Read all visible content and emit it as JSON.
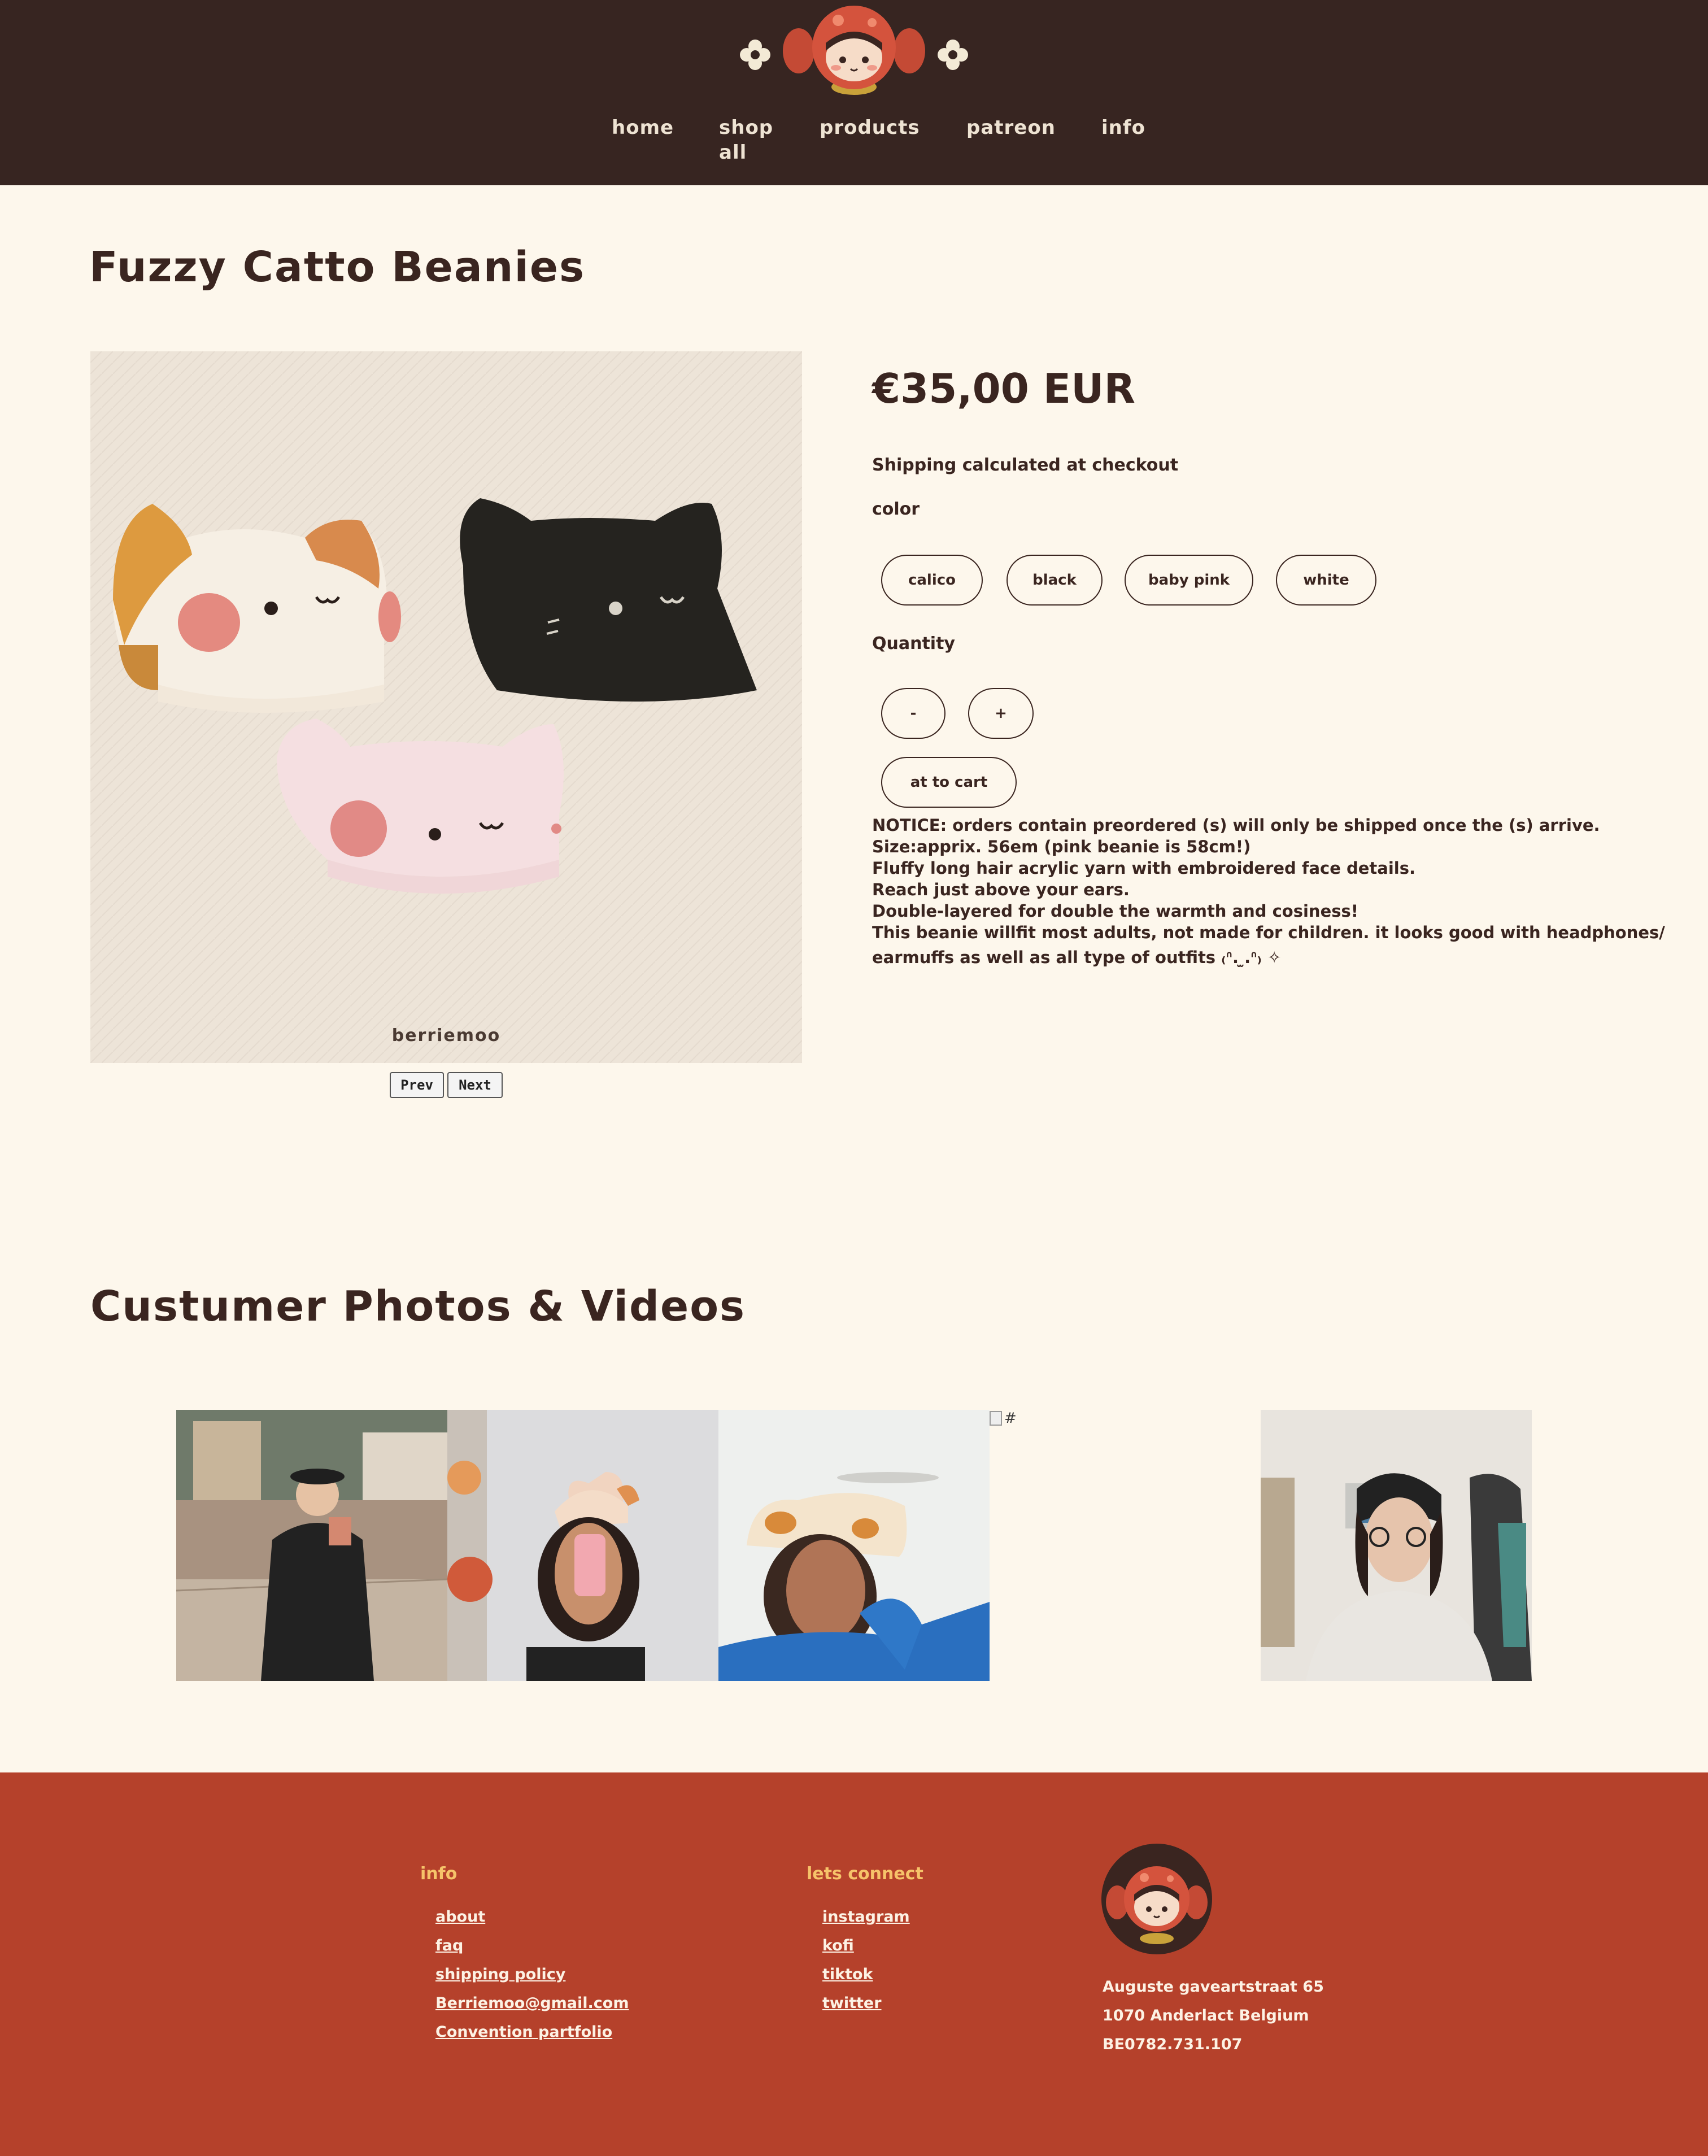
{
  "nav": {
    "items": [
      {
        "label": "home"
      },
      {
        "label": "shop\nall"
      },
      {
        "label": "products"
      },
      {
        "label": "patreon"
      },
      {
        "label": "info"
      }
    ]
  },
  "product": {
    "title": "Fuzzy Catto Beanies",
    "image_caption": "berriemoo",
    "prev_label": "Prev",
    "next_label": "Next",
    "price": "€35,00 EUR",
    "shipping_note": "Shipping calculated at checkout",
    "color_label": "color",
    "colors": [
      "calico",
      "black",
      "baby pink",
      "white"
    ],
    "quantity_label": "Quantity",
    "minus_label": "-",
    "plus_label": "+",
    "add_to_cart_label": "at to cart",
    "description": [
      "NOTICE: orders contain preordered (s) will only be shipped once the (s) arrive.",
      "Size:apprix. 56em (pink beanie is 58cm!)",
      "Fluffy long hair acrylic yarn with embroidered face details.",
      "Reach just above your ears.",
      "Double-layered for double the warmth and cosiness!",
      "This beanie willfit most adults, not made for children. it looks good with headphones/",
      "earmuffs as well as all type of outfits ₍ᐢ. ̫.ᐢ₎ ✧"
    ]
  },
  "customer_section": {
    "title": "Custumer Photos & Videos",
    "broken_image_alt": "#"
  },
  "footer": {
    "info_heading": "info",
    "info_links": [
      "about",
      "faq",
      "shipping policy",
      "Berriemoo@gmail.com",
      "Convention partfolio"
    ],
    "connect_heading": "lets connect",
    "connect_links": [
      "instagram",
      "kofi",
      "tiktok",
      "twitter"
    ],
    "address": [
      "Auguste gaveartstraat 65",
      "1070 Anderlact Belgium",
      "BE0782.731.107"
    ]
  },
  "colors": {
    "header_bg": "#372521",
    "page_bg": "#fdf7ec",
    "footer_bg": "#b5412b",
    "footer_heading": "#f6c36a",
    "text_dark": "#3a2520"
  }
}
